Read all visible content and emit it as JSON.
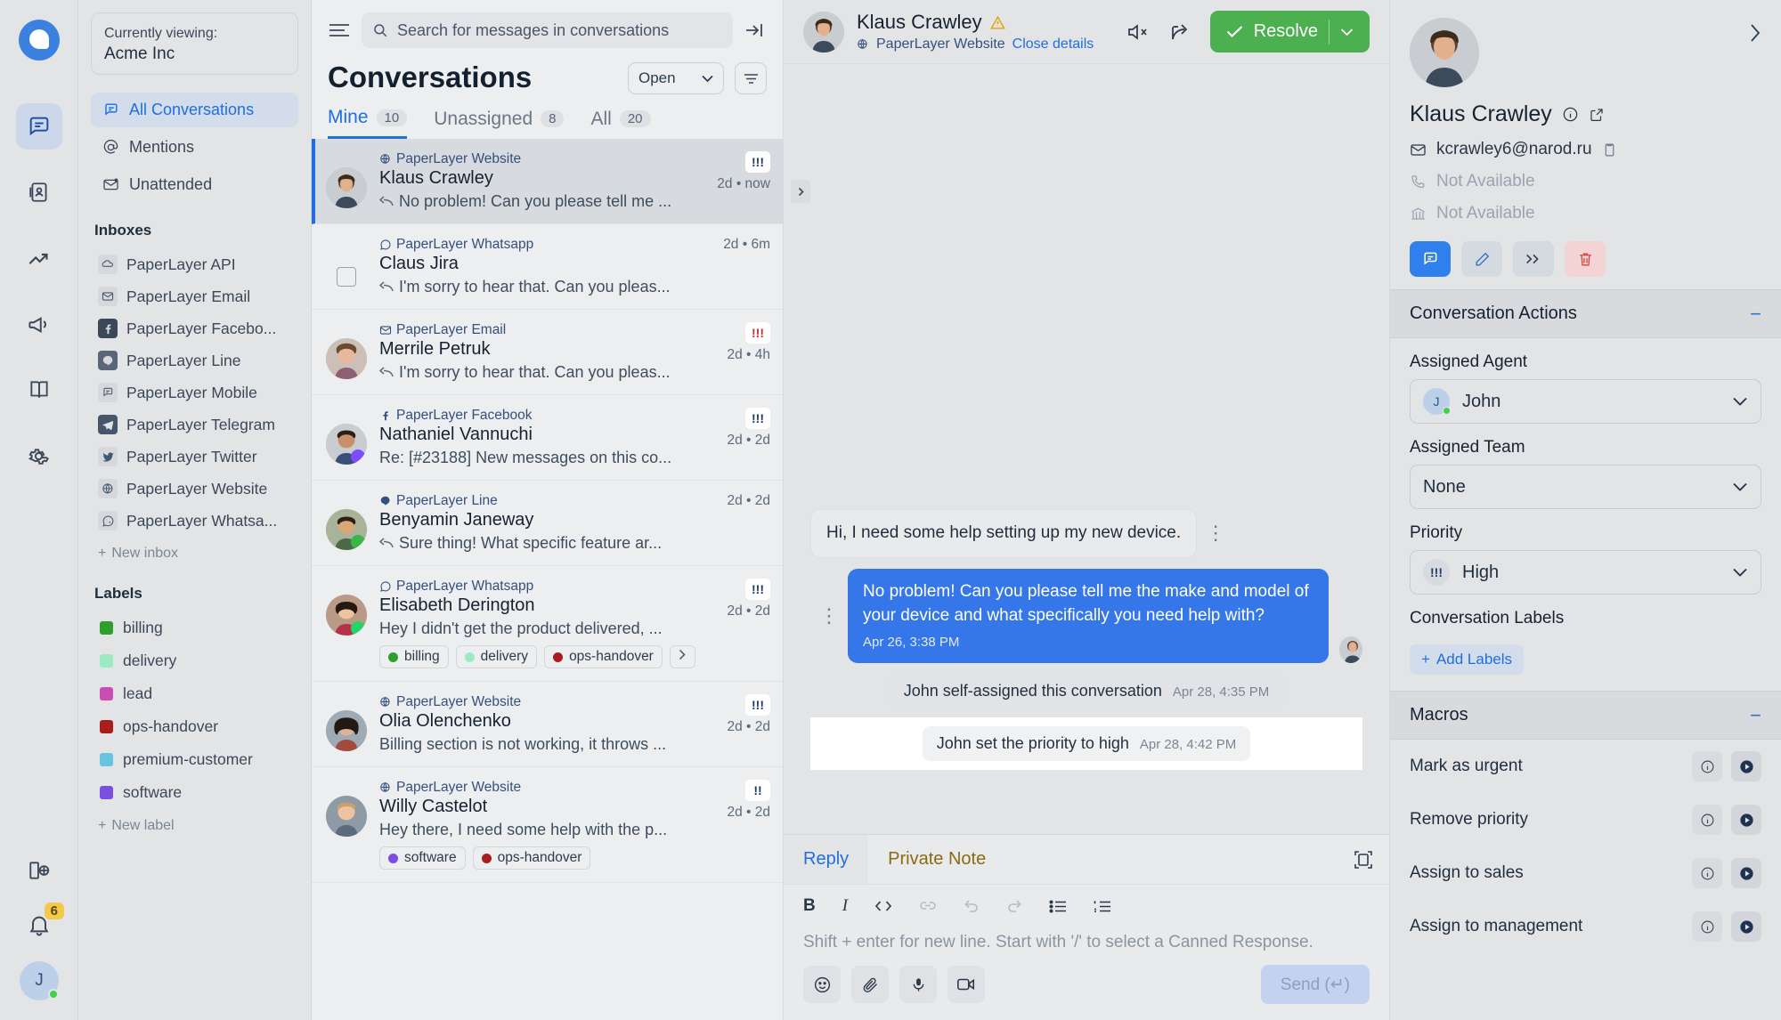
{
  "rail": {
    "logo_name": "chatwoot-logo",
    "items": [
      {
        "name": "conversations",
        "icon": "chat-icon",
        "active": true
      },
      {
        "name": "contacts",
        "icon": "contacts-book-icon",
        "active": false
      },
      {
        "name": "reports",
        "icon": "trending-up-icon",
        "active": false
      },
      {
        "name": "campaigns",
        "icon": "megaphone-icon",
        "active": false
      },
      {
        "name": "help-center",
        "icon": "book-icon",
        "active": false
      },
      {
        "name": "settings",
        "icon": "gear-icon",
        "active": false
      }
    ],
    "bottom": {
      "portal_icon": "portal-icon",
      "notifications_icon": "bell-icon",
      "notifications_count": "6",
      "avatar_initial": "J"
    }
  },
  "sidebar": {
    "viewing_label": "Currently viewing:",
    "account_name": "Acme Inc",
    "nav": [
      {
        "label": "All Conversations",
        "icon": "chat-bubble-icon",
        "active": true
      },
      {
        "label": "Mentions",
        "icon": "at-sign-icon",
        "active": false
      },
      {
        "label": "Unattended",
        "icon": "mail-unread-icon",
        "active": false
      }
    ],
    "inboxes_title": "Inboxes",
    "inboxes": [
      {
        "label": "PaperLayer API",
        "icon": "cloud-icon"
      },
      {
        "label": "PaperLayer Email",
        "icon": "mail-icon"
      },
      {
        "label": "PaperLayer Facebo...",
        "icon": "facebook-icon"
      },
      {
        "label": "PaperLayer Line",
        "icon": "line-icon"
      },
      {
        "label": "PaperLayer Mobile",
        "icon": "chat-icon"
      },
      {
        "label": "PaperLayer Telegram",
        "icon": "telegram-icon"
      },
      {
        "label": "PaperLayer Twitter",
        "icon": "twitter-icon"
      },
      {
        "label": "PaperLayer Website",
        "icon": "globe-icon"
      },
      {
        "label": "PaperLayer Whatsa...",
        "icon": "whatsapp-icon"
      }
    ],
    "new_inbox_label": "New inbox",
    "labels_title": "Labels",
    "labels": [
      {
        "label": "billing",
        "color": "#2f9e2f"
      },
      {
        "label": "delivery",
        "color": "#9ceac4"
      },
      {
        "label": "lead",
        "color": "#cc4db3"
      },
      {
        "label": "ops-handover",
        "color": "#a81d1d"
      },
      {
        "label": "premium-customer",
        "color": "#67c3e0"
      },
      {
        "label": "software",
        "color": "#7a4fe0"
      }
    ],
    "new_label_label": "New label"
  },
  "conversation_list": {
    "search_placeholder": "Search for messages in conversations",
    "title": "Conversations",
    "status_filter": "Open",
    "tabs": [
      {
        "label": "Mine",
        "count": "10",
        "active": true
      },
      {
        "label": "Unassigned",
        "count": "8",
        "active": false
      },
      {
        "label": "All",
        "count": "20",
        "active": false
      }
    ],
    "items": [
      {
        "inbox": "PaperLayer Website",
        "inbox_icon": "globe-icon",
        "name": "Klaus Crawley",
        "preview": "No problem! Can you please tell me ...",
        "has_reply_arrow": true,
        "time": "2d • now",
        "priority": "!!!",
        "priority_color": "blue",
        "selected": true,
        "avatar": "male1",
        "labels": []
      },
      {
        "inbox": "PaperLayer Whatsapp",
        "inbox_icon": "whatsapp-icon",
        "name": "Claus Jira",
        "preview": "I'm sorry to hear that. Can you pleas...",
        "has_reply_arrow": true,
        "time": "2d • 6m",
        "priority": "",
        "priority_color": "",
        "selected": false,
        "avatar": "checkbox",
        "labels": []
      },
      {
        "inbox": "PaperLayer Email",
        "inbox_icon": "mail-icon",
        "name": "Merrile Petruk",
        "preview": "I'm sorry to hear that. Can you pleas...",
        "has_reply_arrow": true,
        "time": "2d • 4h",
        "priority": "!!!",
        "priority_color": "red",
        "selected": false,
        "avatar": "female1",
        "labels": []
      },
      {
        "inbox": "PaperLayer Facebook",
        "inbox_icon": "facebook-icon",
        "name": "Nathaniel Vannuchi",
        "preview": "Re: [#23188] New messages on this co...",
        "has_reply_arrow": false,
        "time": "2d • 2d",
        "priority": "!!!",
        "priority_color": "blue",
        "selected": false,
        "avatar": "male2",
        "labels": []
      },
      {
        "inbox": "PaperLayer Line",
        "inbox_icon": "line-icon",
        "name": "Benyamin Janeway",
        "preview": "Sure thing! What specific feature ar...",
        "has_reply_arrow": true,
        "time": "2d • 2d",
        "priority": "",
        "priority_color": "",
        "selected": false,
        "avatar": "male3",
        "labels": []
      },
      {
        "inbox": "PaperLayer Whatsapp",
        "inbox_icon": "whatsapp-icon",
        "name": "Elisabeth Derington",
        "preview": "Hey I didn't get the product delivered, ...",
        "has_reply_arrow": false,
        "time": "2d • 2d",
        "priority": "!!!",
        "priority_color": "blue",
        "selected": false,
        "avatar": "female2",
        "labels": [
          {
            "label": "billing",
            "color": "#2f9e2f"
          },
          {
            "label": "delivery",
            "color": "#9ceac4"
          },
          {
            "label": "ops-handover",
            "color": "#a81d1d"
          }
        ],
        "labels_more": true
      },
      {
        "inbox": "PaperLayer Website",
        "inbox_icon": "globe-icon",
        "name": "Olia Olenchenko",
        "preview": "Billing section is not working, it throws ...",
        "has_reply_arrow": false,
        "time": "2d • 2d",
        "priority": "!!!",
        "priority_color": "blue",
        "selected": false,
        "avatar": "female3",
        "labels": []
      },
      {
        "inbox": "PaperLayer Website",
        "inbox_icon": "globe-icon",
        "name": "Willy Castelot",
        "preview": "Hey there, I need some help with the p...",
        "has_reply_arrow": false,
        "time": "2d • 2d",
        "priority": "!!",
        "priority_color": "blue",
        "selected": false,
        "avatar": "male4",
        "labels": [
          {
            "label": "software",
            "color": "#7a4fe0"
          },
          {
            "label": "ops-handover",
            "color": "#a81d1d"
          }
        ]
      }
    ]
  },
  "chat_header": {
    "name": "Klaus Crawley",
    "warning_icon": "warning-triangle-icon",
    "inbox": "PaperLayer Website",
    "close_details": "Close details",
    "mute_icon": "mute-icon",
    "share_icon": "share-icon",
    "resolve_label": "Resolve"
  },
  "messages": [
    {
      "type": "incoming",
      "text": "Hi, I need some help setting up my new device.",
      "time": ""
    },
    {
      "type": "outgoing",
      "text": "No problem! Can you please tell me the make and model of your device and what specifically you need help with?",
      "time": "Apr 26, 3:38 PM"
    },
    {
      "type": "system",
      "text": "John self-assigned this conversation",
      "time": "Apr 28, 4:35 PM",
      "highlight": false
    },
    {
      "type": "system",
      "text": "John set the priority to high",
      "time": "Apr 28, 4:42 PM",
      "highlight": true
    }
  ],
  "editor": {
    "tabs": [
      {
        "label": "Reply",
        "active": true
      },
      {
        "label": "Private Note",
        "active": false
      }
    ],
    "expand_icon": "expand-icon",
    "toolbar": [
      {
        "name": "bold-icon",
        "glyph": "B",
        "dim": false
      },
      {
        "name": "italic-icon",
        "glyph": "I",
        "dim": false
      },
      {
        "name": "code-icon",
        "glyph": "</>",
        "dim": false
      },
      {
        "name": "link-icon",
        "glyph": "⚗",
        "dim": true
      },
      {
        "name": "undo-icon",
        "glyph": "↶",
        "dim": true
      },
      {
        "name": "redo-icon",
        "glyph": "↷",
        "dim": true
      },
      {
        "name": "bullet-list-icon",
        "glyph": "☰",
        "dim": false
      },
      {
        "name": "numbered-list-icon",
        "glyph": "≡",
        "dim": false
      }
    ],
    "placeholder": "Shift + enter for new line. Start with '/' to select a Canned Response.",
    "bottom_icons": [
      {
        "name": "emoji-icon"
      },
      {
        "name": "attachment-icon"
      },
      {
        "name": "microphone-icon"
      },
      {
        "name": "video-call-icon"
      }
    ],
    "send_label": "Send (↵)"
  },
  "right_panel": {
    "contact": {
      "name": "Klaus Crawley",
      "info_icon": "info-icon",
      "external_icon": "external-link-icon",
      "email": "kcrawley6@narod.ru",
      "copy_icon": "copy-icon",
      "phone": "Not Available",
      "company": "Not Available",
      "actions": [
        {
          "name": "message-icon",
          "style": "primary"
        },
        {
          "name": "edit-pencil-icon",
          "style": "normal"
        },
        {
          "name": "merge-icon",
          "style": "normal"
        },
        {
          "name": "delete-trash-icon",
          "style": "danger"
        }
      ]
    },
    "conversation_actions": {
      "title": "Conversation Actions",
      "assigned_agent_label": "Assigned Agent",
      "assigned_agent": "John",
      "assigned_agent_initial": "J",
      "assigned_team_label": "Assigned Team",
      "assigned_team": "None",
      "priority_label": "Priority",
      "priority": "High",
      "priority_glyph": "!!!",
      "labels_title": "Conversation Labels",
      "add_labels": "Add Labels"
    },
    "macros": {
      "title": "Macros",
      "items": [
        {
          "label": "Mark as urgent"
        },
        {
          "label": "Remove priority"
        },
        {
          "label": "Assign to sales"
        },
        {
          "label": "Assign to management"
        }
      ]
    }
  },
  "colors": {
    "accent_blue": "#1f6fe0",
    "resolve_green": "#4caf50",
    "bubble_out": "#3577e8"
  }
}
